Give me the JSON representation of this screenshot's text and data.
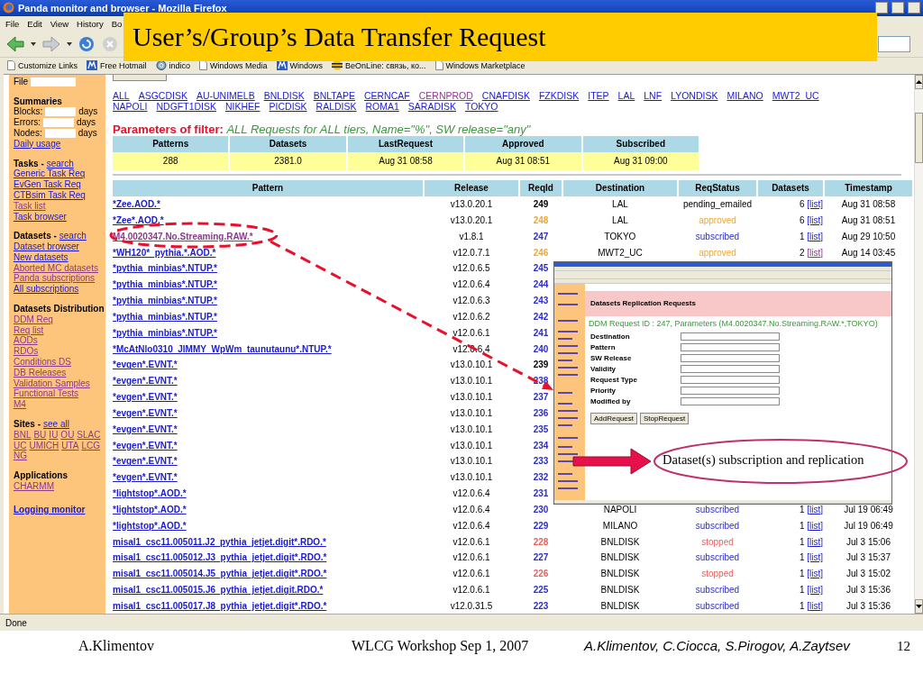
{
  "window": {
    "title": "Panda monitor and browser - Mozilla Firefox"
  },
  "menu": [
    "File",
    "Edit",
    "View",
    "History",
    "Bo"
  ],
  "links_bar": [
    {
      "label": "Customize Links",
      "kind": "page"
    },
    {
      "label": "Free Hotmail",
      "kind": "msn"
    },
    {
      "label": "indico",
      "kind": "globe"
    },
    {
      "label": "Windows Media",
      "kind": "page"
    },
    {
      "label": "Windows",
      "kind": "msn"
    },
    {
      "label": "BeOnLine: связь, ко...",
      "kind": "bee"
    },
    {
      "label": "Windows Marketplace",
      "kind": "page"
    }
  ],
  "slide_title": "User’s/Group’s Data Transfer Request",
  "sidebar": {
    "file_label": "File",
    "summaries_title": "Summaries",
    "summary_rows": [
      {
        "label": "Blocks:",
        "unit": "days"
      },
      {
        "label": "Errors:",
        "unit": "days"
      },
      {
        "label": "Nodes:",
        "unit": "days"
      }
    ],
    "sections": [
      {
        "items": [
          {
            "label": "Daily usage",
            "visited": false
          }
        ]
      },
      {
        "title": "Tasks -",
        "search": "search",
        "items": [
          {
            "label": "Generic Task Req",
            "visited": false
          },
          {
            "label": "EvGen Task Req",
            "visited": false
          },
          {
            "label": "CTBsim Task Req",
            "visited": false
          },
          {
            "label": "Task list",
            "visited": true
          },
          {
            "label": "Task browser",
            "visited": false
          }
        ]
      },
      {
        "title": "Datasets -",
        "search": "search",
        "items": [
          {
            "label": "Dataset browser",
            "visited": false
          },
          {
            "label": "New datasets",
            "visited": false
          },
          {
            "label": "Aborted MC datasets",
            "visited": true
          },
          {
            "label": "Panda subscriptions",
            "visited": true
          },
          {
            "label": "All subscriptions",
            "visited": false
          }
        ]
      },
      {
        "title": "Datasets Distribution",
        "items": [
          {
            "label": "DDM Req",
            "visited": true
          },
          {
            "label": "Req list",
            "visited": true
          },
          {
            "label": "AODs",
            "visited": true
          },
          {
            "label": "RDOs",
            "visited": true
          },
          {
            "label": "Conditions DS",
            "visited": true
          },
          {
            "label": "DB Releases",
            "visited": true
          },
          {
            "label": "Validation Samples",
            "visited": true
          },
          {
            "label": "Functional Tests",
            "visited": true
          },
          {
            "label": "M4",
            "visited": true
          }
        ]
      },
      {
        "title": "Sites -",
        "search": "see all",
        "inline": true,
        "items": [
          {
            "label": "BNL",
            "visited": true
          },
          {
            "label": "BU",
            "visited": true
          },
          {
            "label": "IU",
            "visited": true
          },
          {
            "label": "OU",
            "visited": true
          },
          {
            "label": "SLAC",
            "visited": true
          },
          {
            "label": "UC",
            "visited": true
          },
          {
            "label": "UMICH",
            "visited": true
          },
          {
            "label": "UTA",
            "visited": true
          },
          {
            "label": "LCG",
            "visited": true
          },
          {
            "label": "NG",
            "visited": true
          }
        ]
      },
      {
        "title": "Applications",
        "items": [
          {
            "label": "CHARMM",
            "visited": true
          }
        ]
      }
    ],
    "footer_link": "Logging monitor"
  },
  "site_links": [
    [
      {
        "label": "ALL",
        "visited": false
      },
      {
        "label": "ASGCDISK",
        "visited": false
      },
      {
        "label": "AU-UNIMELB",
        "visited": false
      },
      {
        "label": "BNLDISK",
        "visited": false
      },
      {
        "label": "BNLTAPE",
        "visited": false
      },
      {
        "label": "CERNCAF",
        "visited": false
      },
      {
        "label": "CERNPROD",
        "visited": true
      },
      {
        "label": "CNAFDISK",
        "visited": false
      },
      {
        "label": "FZKDISK",
        "visited": false
      },
      {
        "label": "ITEP",
        "visited": false
      },
      {
        "label": "LAL",
        "visited": false
      },
      {
        "label": "LNF",
        "visited": false
      },
      {
        "label": "LYONDISK",
        "visited": false
      },
      {
        "label": "MILANO",
        "visited": false
      },
      {
        "label": "MWT2_UC",
        "visited": false
      }
    ],
    [
      {
        "label": "NAPOLI",
        "visited": false
      },
      {
        "label": "NDGFT1DISK",
        "visited": false
      },
      {
        "label": "NIKHEF",
        "visited": false
      },
      {
        "label": "PICDISK",
        "visited": false
      },
      {
        "label": "RALDISK",
        "visited": false
      },
      {
        "label": "ROMA1",
        "visited": false
      },
      {
        "label": "SARADISK",
        "visited": false
      },
      {
        "label": "TOKYO",
        "visited": false
      }
    ]
  ],
  "filter": {
    "label": "Parameters of filter:",
    "value": "ALL Requests for ALL tiers, Name=\"%\", SW release=\"any\""
  },
  "summary": {
    "columns": [
      "Patterns",
      "Datasets",
      "LastRequest",
      "Approved",
      "Subscribed"
    ],
    "values": [
      "288",
      "2381.0",
      "Aug 31 08:58",
      "Aug 31 08:51",
      "Aug 31 09:00"
    ]
  },
  "table": {
    "columns": [
      "Pattern",
      "Release",
      "ReqId",
      "Destination",
      "ReqStatus",
      "Datasets",
      "Timestamp"
    ],
    "rows": [
      {
        "pattern": "*Zee.AOD.*",
        "visited": false,
        "release": "v13.0.20.1",
        "reqid": "249",
        "color": "#000000",
        "destination": "LAL",
        "status": "pending_emailed",
        "datasets": "6",
        "list": "[list]",
        "list_visited": false,
        "timestamp": "Aug 31 08:58"
      },
      {
        "pattern": "*Zee*.AOD.*",
        "visited": false,
        "release": "v13.0.20.1",
        "reqid": "248",
        "color": "#f0a830",
        "destination": "LAL",
        "status": "approved",
        "datasets": "6",
        "list": "[list]",
        "list_visited": false,
        "timestamp": "Aug 31 08:51"
      },
      {
        "pattern": "M4.0020347.No.Streaming.RAW.*",
        "visited": true,
        "release": "v1.8.1",
        "reqid": "247",
        "color": "#2c2cc8",
        "destination": "TOKYO",
        "status": "subscribed",
        "datasets": "1",
        "list": "[list]",
        "list_visited": false,
        "timestamp": "Aug 29 10:50"
      },
      {
        "pattern": "*WH120*_pythia.*.AOD.*",
        "visited": false,
        "release": "v12.0.7.1",
        "reqid": "246",
        "color": "#f0a830",
        "destination": "MWT2_UC",
        "status": "approved",
        "datasets": "2",
        "list": "[list]",
        "list_visited": true,
        "timestamp": "Aug 14 03:45"
      },
      {
        "pattern": "*pythia_minbias*.NTUP.*",
        "visited": false,
        "release": "v12.0.6.5",
        "reqid": "245",
        "color": "#2c2cc8"
      },
      {
        "pattern": "*pythia_minbias*.NTUP.*",
        "visited": false,
        "release": "v12.0.6.4",
        "reqid": "244",
        "color": "#2c2cc8"
      },
      {
        "pattern": "*pythia_minbias*.NTUP.*",
        "visited": false,
        "release": "v12.0.6.3",
        "reqid": "243",
        "color": "#2c2cc8"
      },
      {
        "pattern": "*pythia_minbias*.NTUP.*",
        "visited": false,
        "release": "v12.0.6.2",
        "reqid": "242",
        "color": "#2c2cc8"
      },
      {
        "pattern": "*pythia_minbias*.NTUP.*",
        "visited": false,
        "release": "v12.0.6.1",
        "reqid": "241",
        "color": "#2c2cc8"
      },
      {
        "pattern": "*McAtNlo0310_JIMMY_WpWm_taunutaunu*.NTUP.*",
        "visited": false,
        "release": "v12.0.6.4",
        "reqid": "240",
        "color": "#2c2cc8"
      },
      {
        "pattern": "*evgen*.EVNT.*",
        "visited": false,
        "release": "v13.0.10.1",
        "reqid": "239",
        "color": "#000000"
      },
      {
        "pattern": "*evgen*.EVNT.*",
        "visited": false,
        "release": "v13.0.10.1",
        "reqid": "238",
        "color": "#2c2cc8"
      },
      {
        "pattern": "*evgen*.EVNT.*",
        "visited": false,
        "release": "v13.0.10.1",
        "reqid": "237",
        "color": "#2c2cc8"
      },
      {
        "pattern": "*evgen*.EVNT.*",
        "visited": false,
        "release": "v13.0.10.1",
        "reqid": "236",
        "color": "#2c2cc8"
      },
      {
        "pattern": "*evgen*.EVNT.*",
        "visited": false,
        "release": "v13.0.10.1",
        "reqid": "235",
        "color": "#2c2cc8"
      },
      {
        "pattern": "*evgen*.EVNT.*",
        "visited": false,
        "release": "v13.0.10.1",
        "reqid": "234",
        "color": "#2c2cc8"
      },
      {
        "pattern": "*evgen*.EVNT.*",
        "visited": false,
        "release": "v13.0.10.1",
        "reqid": "233",
        "color": "#2c2cc8"
      },
      {
        "pattern": "*evgen*.EVNT.*",
        "visited": false,
        "release": "v13.0.10.1",
        "reqid": "232",
        "color": "#2c2cc8"
      },
      {
        "pattern": "*lightstop*.AOD.*",
        "visited": false,
        "release": "v12.0.6.4",
        "reqid": "231",
        "color": "#2c2cc8"
      },
      {
        "pattern": "*lightstop*.AOD.*",
        "visited": false,
        "release": "v12.0.6.4",
        "reqid": "230",
        "color": "#2c2cc8",
        "destination": "NAPOLI",
        "status": "subscribed",
        "datasets": "1",
        "list": "[list]",
        "list_visited": false,
        "timestamp": "Jul 19 06:49"
      },
      {
        "pattern": "*lightstop*.AOD.*",
        "visited": false,
        "release": "v12.0.6.4",
        "reqid": "229",
        "color": "#2c2cc8",
        "destination": "MILANO",
        "status": "subscribed",
        "datasets": "1",
        "list": "[list]",
        "list_visited": false,
        "timestamp": "Jul 19 06:49"
      },
      {
        "pattern": "misal1_csc11.005011.J2_pythia_jetjet.digit*.RDO.*",
        "visited": false,
        "release": "v12.0.6.1",
        "reqid": "228",
        "color": "#e86060",
        "destination": "BNLDISK",
        "status": "stopped",
        "datasets": "1",
        "list": "[list]",
        "list_visited": false,
        "timestamp": "Jul 3 15:06"
      },
      {
        "pattern": "misal1_csc11.005012.J3_pythia_jetjet.digit*.RDO.*",
        "visited": false,
        "release": "v12.0.6.1",
        "reqid": "227",
        "color": "#2c2cc8",
        "destination": "BNLDISK",
        "status": "subscribed",
        "datasets": "1",
        "list": "[list]",
        "list_visited": false,
        "timestamp": "Jul 3 15:37"
      },
      {
        "pattern": "misal1_csc11.005014.J5_pythia_jetjet.digit*.RDO.*",
        "visited": false,
        "release": "v12.0.6.1",
        "reqid": "226",
        "color": "#e86060",
        "destination": "BNLDISK",
        "status": "stopped",
        "datasets": "1",
        "list": "[list]",
        "list_visited": false,
        "timestamp": "Jul 3 15:02"
      },
      {
        "pattern": "misal1_csc11.005015.J6_pythia_jetjet.digit.RDO.*",
        "visited": false,
        "release": "v12.0.6.1",
        "reqid": "225",
        "color": "#2c2cc8",
        "destination": "BNLDISK",
        "status": "subscribed",
        "datasets": "1",
        "list": "[list]",
        "list_visited": false,
        "timestamp": "Jul 3 15:36"
      },
      {
        "pattern": "misal1_csc11.005017.J8_pythia_jetjet.digit*.RDO.*",
        "visited": false,
        "release": "v12.0.31.5",
        "reqid": "223",
        "color": "#2c2cc8",
        "destination": "BNLDISK",
        "status": "subscribed",
        "datasets": "1",
        "list": "[list]",
        "list_visited": false,
        "timestamp": "Jul 3 15:36"
      }
    ]
  },
  "inset_window": {
    "header": "Datasets Replication Requests",
    "request_title": "DDM Request ID : 247, Parameters (M4.0020347.No.Streaming.RAW.*,TOKYO)",
    "form_labels": [
      "Destination",
      "Pattern",
      "SW Release",
      "Validity",
      "Request Type",
      "Priority",
      "Modified by"
    ],
    "buttons": [
      "AddRequest",
      "StopRequest"
    ]
  },
  "callout": "Dataset(s) subscription and replication",
  "status_bar": "Done",
  "footer": {
    "left": "A.Klimentov",
    "center": "WLCG Workshop Sep 1, 2007",
    "authors": "A.Klimentov, C.Ciocca, S.Pirogov, A.Zaytsev",
    "page": "12"
  }
}
